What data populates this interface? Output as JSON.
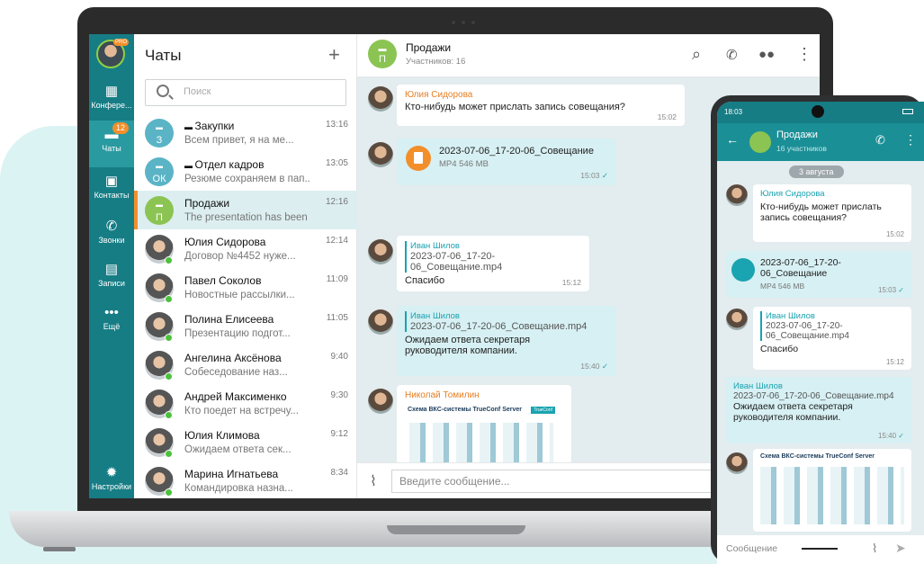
{
  "rail": {
    "pro": "PRO",
    "items": [
      {
        "label": "Конфере...",
        "icon": "conference-icon"
      },
      {
        "label": "Чаты",
        "icon": "chats-icon",
        "badge": "12"
      },
      {
        "label": "Контакты",
        "icon": "contacts-icon"
      },
      {
        "label": "Звонки",
        "icon": "calls-icon"
      },
      {
        "label": "Записи",
        "icon": "records-icon"
      },
      {
        "label": "Ещё",
        "icon": "more-icon"
      },
      {
        "label": "Настройки",
        "icon": "settings-icon"
      }
    ]
  },
  "list": {
    "title": "Чаты",
    "search_placeholder": "Поиск",
    "rows": [
      {
        "initials": "З",
        "name": "Закупки",
        "preview": "Всем привет, я на ме...",
        "time": "13:16"
      },
      {
        "initials": "ОК",
        "name": "Отдел кадров",
        "preview": "Резюме сохраняем в пап...",
        "time": "13:05"
      },
      {
        "initials": "П",
        "name": "Продажи",
        "preview": "The presentation has been",
        "time": "12:16"
      },
      {
        "name": "Юлия Сидорова",
        "preview": "Договор №4452 нуже...",
        "time": "12:14"
      },
      {
        "name": "Павел Соколов",
        "preview": "Новостные рассылки...",
        "time": "11:09"
      },
      {
        "name": "Полина Елисеева",
        "preview": "Презентацию подгот...",
        "time": "11:05"
      },
      {
        "name": "Ангелина Аксёнова",
        "preview": "Собеседование наз...",
        "time": "9:40"
      },
      {
        "name": "Андрей Максименко",
        "preview": "Кто поедет на встречу...",
        "time": "9:30"
      },
      {
        "name": "Юлия Климова",
        "preview": "Ожидаем ответа сек...",
        "time": "9:12"
      },
      {
        "name": "Марина Игнатьева",
        "preview": "Командировка назна...",
        "time": "8:34"
      }
    ]
  },
  "header": {
    "initials": "П",
    "title": "Продажи",
    "subtitle": "Участников: 16"
  },
  "messages": {
    "m1": {
      "author": "Юлия Сидорова",
      "text": "Кто-нибудь может прислать запись совещания?",
      "time": "15:02"
    },
    "m2": {
      "file": "2023-07-06_17-20-06_Совещание",
      "meta": "MP4 546 MB",
      "time": "15:03"
    },
    "m3": {
      "quote_author": "Иван Шилов",
      "quote_text": "2023-07-06_17-20-06_Совещание.mp4",
      "text": "Спасибо",
      "time": "15:12"
    },
    "m4": {
      "quote_author": "Иван Шилов",
      "quote_text": "2023-07-06_17-20-06_Совещание.mp4",
      "text": "Ожидаем ответа секретаря руководителя компании.",
      "time": "15:40"
    },
    "m5": {
      "author": "Николай Томилин",
      "image_title": "Схема ВКС-системы TrueConf Server",
      "logo": "TrueConf"
    }
  },
  "composer": {
    "placeholder": "Введите сообщение..."
  },
  "phone": {
    "clock": "18:03",
    "title": "Продажи",
    "subtitle": "16 участников",
    "date": "3 августа",
    "m1": {
      "author": "Юлия Сидорова",
      "text": "Кто-нибудь может прислать запись совещания?",
      "time": "15:02"
    },
    "m2": {
      "file": "2023-07-06_17-20-06_Совещание",
      "meta": "MP4 546 MB",
      "time": "15:03"
    },
    "m3": {
      "quote_author": "Иван Шилов",
      "quote_text": "2023-07-06_17-20-06_Совещание.mp4",
      "text": "Спасибо",
      "time": "15:12"
    },
    "m4": {
      "quote_author": "Иван Шилов",
      "quote_text": "2023-07-06_17-20-06_Совещание.mp4",
      "text": "Ожидаем ответа секретаря руководителя компании.",
      "time": "15:40"
    },
    "m5": {
      "image_title": "Схема ВКС-системы TrueConf Server"
    },
    "composer_placeholder": "Сообщение"
  },
  "colors": {
    "rail": "#167d85",
    "accent": "#f28f2a",
    "teal": "#1aa3b0"
  }
}
